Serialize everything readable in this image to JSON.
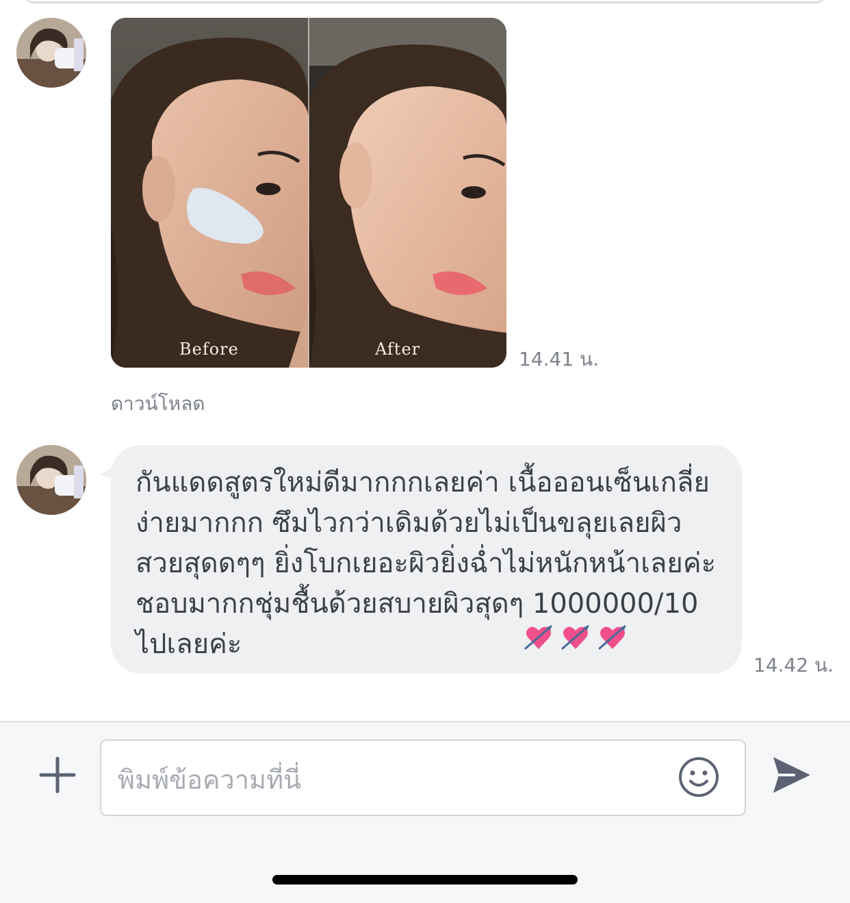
{
  "messages": [
    {
      "type": "image",
      "avatar_icon": "user-avatar",
      "labels": {
        "before": "Before",
        "after": "After"
      },
      "time": "14.41 น.",
      "download_label": "ดาวน์โหลด"
    },
    {
      "type": "text",
      "avatar_icon": "user-avatar",
      "text": "กันแดดสูตรใหม่ดีมากกกเลยค่า เนื้อออนเซ็นเกลี่ยง่ายมากกก ซึมไวกว่าเดิมด้วยไม่เป็นขลุยเลยผิวสวยสุดดๆๆ ยิ่งโบกเยอะผิวยิ่งฉ่ำไม่หนักหน้าเลยค่ะ ชอบมากกชุ่มชื้นด้วยสบายผิวสุดๆ 1000000/10 ไปเลยค่ะ",
      "emoji": [
        "heart-with-arrow",
        "heart-with-arrow",
        "heart-with-arrow"
      ],
      "time": "14.42 น."
    }
  ],
  "composer": {
    "placeholder": "พิมพ์ข้อความที่นี่",
    "value": "",
    "icons": {
      "add": "plus-icon",
      "emoji": "smiley-icon",
      "send": "send-arrow-icon"
    }
  },
  "colors": {
    "bubble": "#eff0f2",
    "text": "#3c4048",
    "muted": "#7d828b",
    "composer_bg": "#f6f7f9",
    "icon": "#5c6274",
    "heart": "#ef4f8a"
  }
}
